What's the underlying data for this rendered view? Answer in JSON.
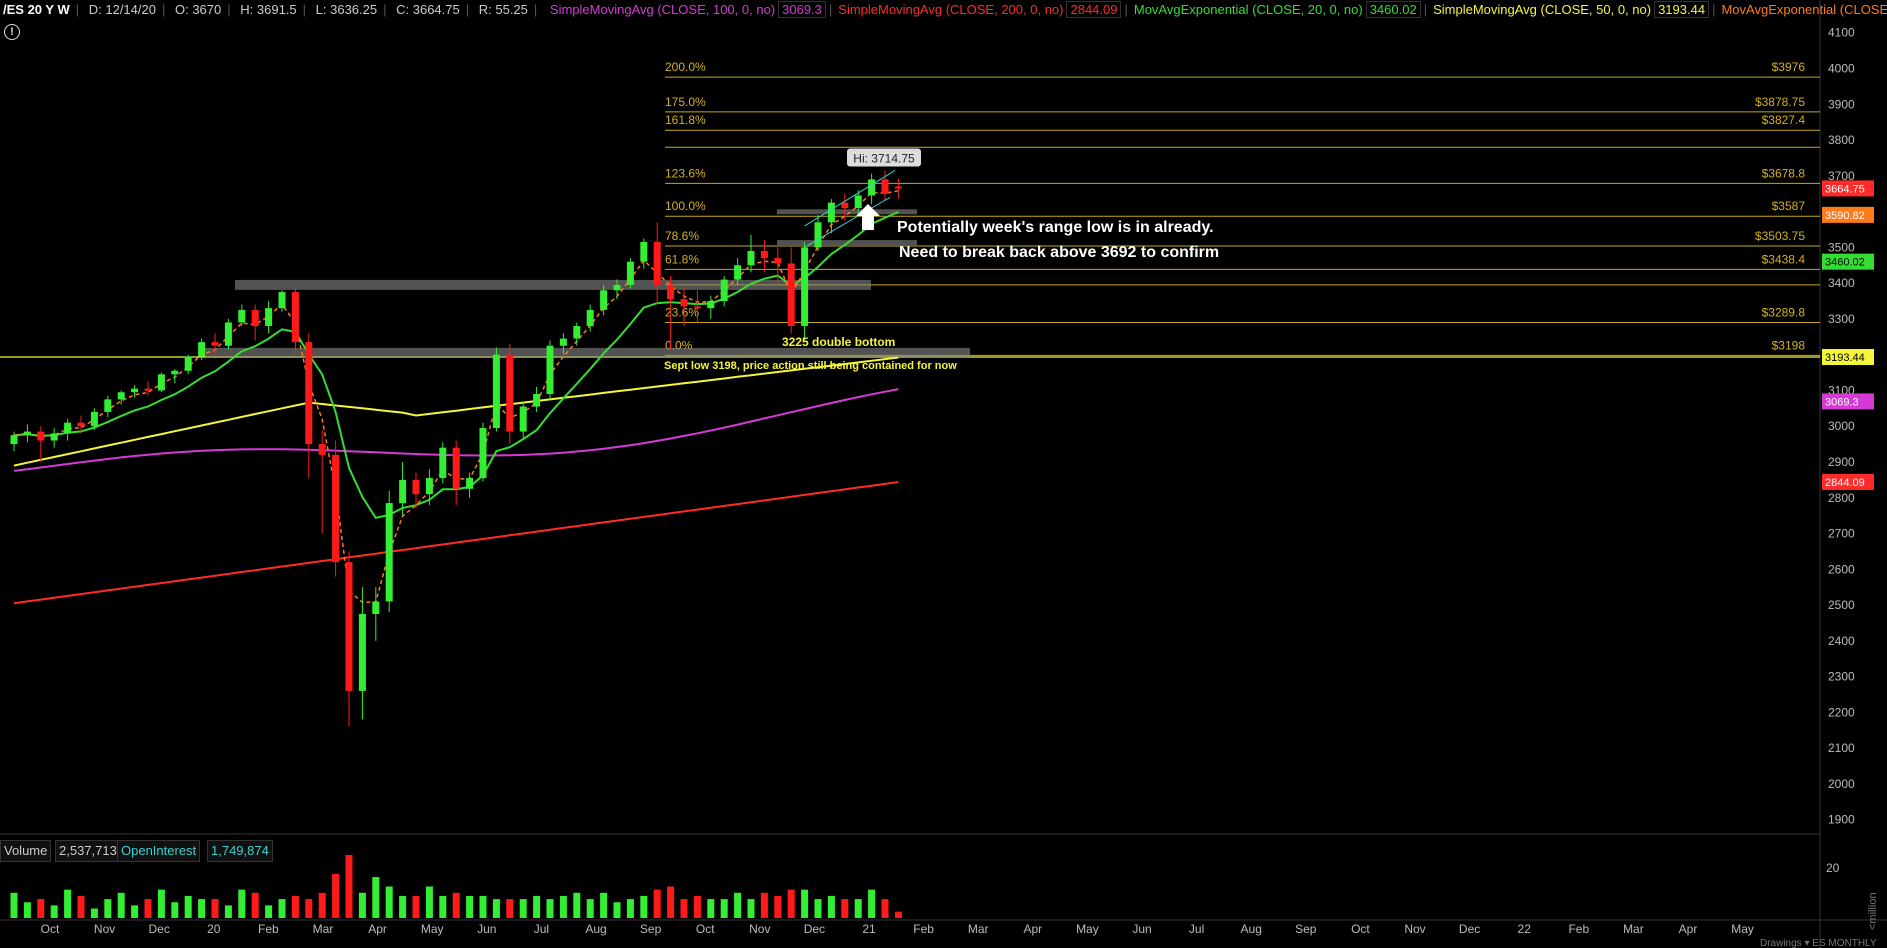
{
  "topbar": {
    "symbol": "/ES 20 Y W",
    "date": "D: 12/14/20",
    "open": "O: 3670",
    "high": "H: 3691.5",
    "low": "L: 3636.25",
    "close": "C: 3664.75",
    "range": "R: 55.25",
    "studies": [
      {
        "label": "SimpleMovingAvg (CLOSE, 100, 0, no)",
        "value": "3069.3",
        "color": "#d63ad6"
      },
      {
        "label": "SimpleMovingAvg (CLOSE, 200, 0, no)",
        "value": "2844.09",
        "color": "#ff2a2a"
      },
      {
        "label": "MovAvgExponential (CLOSE, 20, 0, no)",
        "value": "3460.02",
        "color": "#33dd33"
      },
      {
        "label": "SimpleMovingAvg (CLOSE, 50, 0, no)",
        "value": "3193.44",
        "color": "#f5f53a"
      },
      {
        "label": "MovAvgExponential (CLOSE, 8, 0, no)",
        "value": "",
        "color": "#ff7a1a"
      }
    ],
    "more": "..."
  },
  "info_icon": "!",
  "chart_data": {
    "type": "candlestick",
    "x_tick_labels": [
      "Oct",
      "Nov",
      "Dec",
      "20",
      "Feb",
      "Mar",
      "Apr",
      "May",
      "Jun",
      "Jul",
      "Aug",
      "Sep",
      "Oct",
      "Nov",
      "Dec",
      "21",
      "Feb",
      "Mar",
      "Apr",
      "May",
      "Jun",
      "Jul",
      "Aug",
      "Sep",
      "Oct",
      "Nov",
      "Dec",
      "22",
      "Feb",
      "Mar",
      "Apr",
      "May"
    ],
    "y_ticks": [
      1900,
      2000,
      2100,
      2200,
      2300,
      2400,
      2500,
      2600,
      2700,
      2800,
      2900,
      3000,
      3100,
      3200,
      3300,
      3400,
      3500,
      3600,
      3700,
      3800,
      3900,
      4000,
      4100
    ],
    "ylim": [
      1860,
      4130
    ],
    "last_price": 3664.75,
    "price_tags": [
      {
        "value": 3664.75,
        "text": "3664.75",
        "color": "#ff2a2a"
      },
      {
        "value": 3590.82,
        "text": "3590.82",
        "color": "#ff7a1a"
      },
      {
        "value": 3460.02,
        "text": "3460.02",
        "color": "#33dd33"
      },
      {
        "value": 3193.44,
        "text": "3193.44",
        "color": "#f5f53a"
      },
      {
        "value": 3069.3,
        "text": "3069.3",
        "color": "#d63ad6"
      },
      {
        "value": 2844.09,
        "text": "2844.09",
        "color": "#ff2a2a"
      }
    ],
    "fib_levels": [
      {
        "pct": "200.0%",
        "value": 3976,
        "text": "$3976"
      },
      {
        "pct": "175.0%",
        "value": 3878.75,
        "text": "$3878.75"
      },
      {
        "pct": "161.8%",
        "value": 3827.4,
        "text": "$3827.4"
      },
      {
        "pct": "",
        "value": 3780,
        "text": ""
      },
      {
        "pct": "123.6%",
        "value": 3678.8,
        "text": "$3678.8"
      },
      {
        "pct": "100.0%",
        "value": 3587,
        "text": "$3587"
      },
      {
        "pct": "78.6%",
        "value": 3503.75,
        "text": "$3503.75"
      },
      {
        "pct": "61.8%",
        "value": 3438.4,
        "text": "$3438.4"
      },
      {
        "pct": "",
        "value": 3395,
        "text": ""
      },
      {
        "pct": "23.6%",
        "value": 3289.8,
        "text": "$3289.8"
      },
      {
        "pct": "0.0%",
        "value": 3198,
        "text": "$3198"
      }
    ],
    "candles": [
      [
        2950,
        2985,
        2930,
        2975
      ],
      [
        2975,
        3005,
        2955,
        2985
      ],
      [
        2985,
        3000,
        2900,
        2960
      ],
      [
        2960,
        2995,
        2940,
        2980
      ],
      [
        2980,
        3020,
        2960,
        3010
      ],
      [
        3010,
        3030,
        2980,
        3000
      ],
      [
        3000,
        3050,
        2990,
        3040
      ],
      [
        3040,
        3085,
        3025,
        3075
      ],
      [
        3075,
        3100,
        3060,
        3095
      ],
      [
        3095,
        3115,
        3080,
        3105
      ],
      [
        3105,
        3125,
        3085,
        3100
      ],
      [
        3100,
        3150,
        3095,
        3145
      ],
      [
        3145,
        3160,
        3120,
        3155
      ],
      [
        3155,
        3200,
        3145,
        3195
      ],
      [
        3195,
        3245,
        3185,
        3235
      ],
      [
        3235,
        3260,
        3200,
        3225
      ],
      [
        3225,
        3300,
        3215,
        3290
      ],
      [
        3290,
        3340,
        3280,
        3325
      ],
      [
        3325,
        3340,
        3240,
        3280
      ],
      [
        3280,
        3350,
        3260,
        3330
      ],
      [
        3330,
        3380,
        3320,
        3375
      ],
      [
        3375,
        3390,
        3200,
        3235
      ],
      [
        3235,
        3260,
        2855,
        2950
      ],
      [
        2950,
        2990,
        2700,
        2920
      ],
      [
        2920,
        2960,
        2580,
        2620
      ],
      [
        2620,
        2650,
        2160,
        2260
      ],
      [
        2260,
        2550,
        2180,
        2475
      ],
      [
        2475,
        2550,
        2400,
        2510
      ],
      [
        2510,
        2820,
        2480,
        2785
      ],
      [
        2785,
        2900,
        2750,
        2850
      ],
      [
        2850,
        2870,
        2770,
        2810
      ],
      [
        2810,
        2880,
        2780,
        2855
      ],
      [
        2855,
        2955,
        2840,
        2940
      ],
      [
        2940,
        2960,
        2780,
        2825
      ],
      [
        2825,
        2870,
        2800,
        2855
      ],
      [
        2855,
        3010,
        2845,
        2995
      ],
      [
        2995,
        3220,
        2985,
        3200
      ],
      [
        3200,
        3230,
        2950,
        2985
      ],
      [
        2985,
        3070,
        2965,
        3055
      ],
      [
        3055,
        3110,
        3040,
        3090
      ],
      [
        3090,
        3240,
        3075,
        3225
      ],
      [
        3225,
        3260,
        3200,
        3245
      ],
      [
        3245,
        3290,
        3225,
        3280
      ],
      [
        3280,
        3340,
        3265,
        3325
      ],
      [
        3325,
        3395,
        3310,
        3380
      ],
      [
        3380,
        3410,
        3355,
        3395
      ],
      [
        3395,
        3470,
        3385,
        3460
      ],
      [
        3460,
        3525,
        3440,
        3515
      ],
      [
        3515,
        3570,
        3340,
        3395
      ],
      [
        3395,
        3420,
        3215,
        3355
      ],
      [
        3355,
        3390,
        3280,
        3335
      ],
      [
        3335,
        3380,
        3290,
        3330
      ],
      [
        3330,
        3365,
        3300,
        3350
      ],
      [
        3350,
        3420,
        3335,
        3410
      ],
      [
        3410,
        3470,
        3395,
        3450
      ],
      [
        3450,
        3535,
        3430,
        3490
      ],
      [
        3490,
        3520,
        3430,
        3470
      ],
      [
        3470,
        3500,
        3400,
        3455
      ],
      [
        3455,
        3500,
        3260,
        3280
      ],
      [
        3280,
        3515,
        3240,
        3500
      ],
      [
        3500,
        3590,
        3490,
        3570
      ],
      [
        3570,
        3635,
        3540,
        3625
      ],
      [
        3625,
        3650,
        3575,
        3610
      ],
      [
        3610,
        3660,
        3590,
        3645
      ],
      [
        3645,
        3706,
        3620,
        3690
      ],
      [
        3690,
        3715,
        3630,
        3650
      ],
      [
        3670,
        3692,
        3636,
        3665
      ]
    ],
    "volume": [
      0.4,
      0.25,
      0.3,
      0.2,
      0.45,
      0.35,
      0.15,
      0.3,
      0.4,
      0.2,
      0.3,
      0.45,
      0.25,
      0.35,
      0.3,
      0.3,
      0.2,
      0.45,
      0.4,
      0.2,
      0.3,
      0.35,
      0.3,
      0.4,
      0.7,
      1.0,
      0.4,
      0.65,
      0.5,
      0.35,
      0.35,
      0.5,
      0.35,
      0.4,
      0.35,
      0.35,
      0.3,
      0.3,
      0.3,
      0.35,
      0.3,
      0.35,
      0.4,
      0.3,
      0.4,
      0.25,
      0.3,
      0.35,
      0.45,
      0.5,
      0.3,
      0.35,
      0.3,
      0.3,
      0.4,
      0.3,
      0.4,
      0.35,
      0.45,
      0.45,
      0.3,
      0.35,
      0.3,
      0.3,
      0.45,
      0.3,
      0.1
    ],
    "volume_axis_tick": "20",
    "volume_axis_unit": "<million",
    "volume_labels": {
      "name": "Volume",
      "value": "2,537,713",
      "oi_name": "OpenInterest",
      "oi_value": "1,749,874"
    },
    "annotations": {
      "hi_label": "Hi: 3714.75",
      "note1": "Potentially week's range low is in already.",
      "note2": "Need to break back above 3692 to confirm",
      "double_bottom": "3225 double bottom",
      "sept_low": "Sept low 3198, price action still being contained for now"
    },
    "bottom_right_text": "Drawings ▾  ES MONTHLY"
  }
}
